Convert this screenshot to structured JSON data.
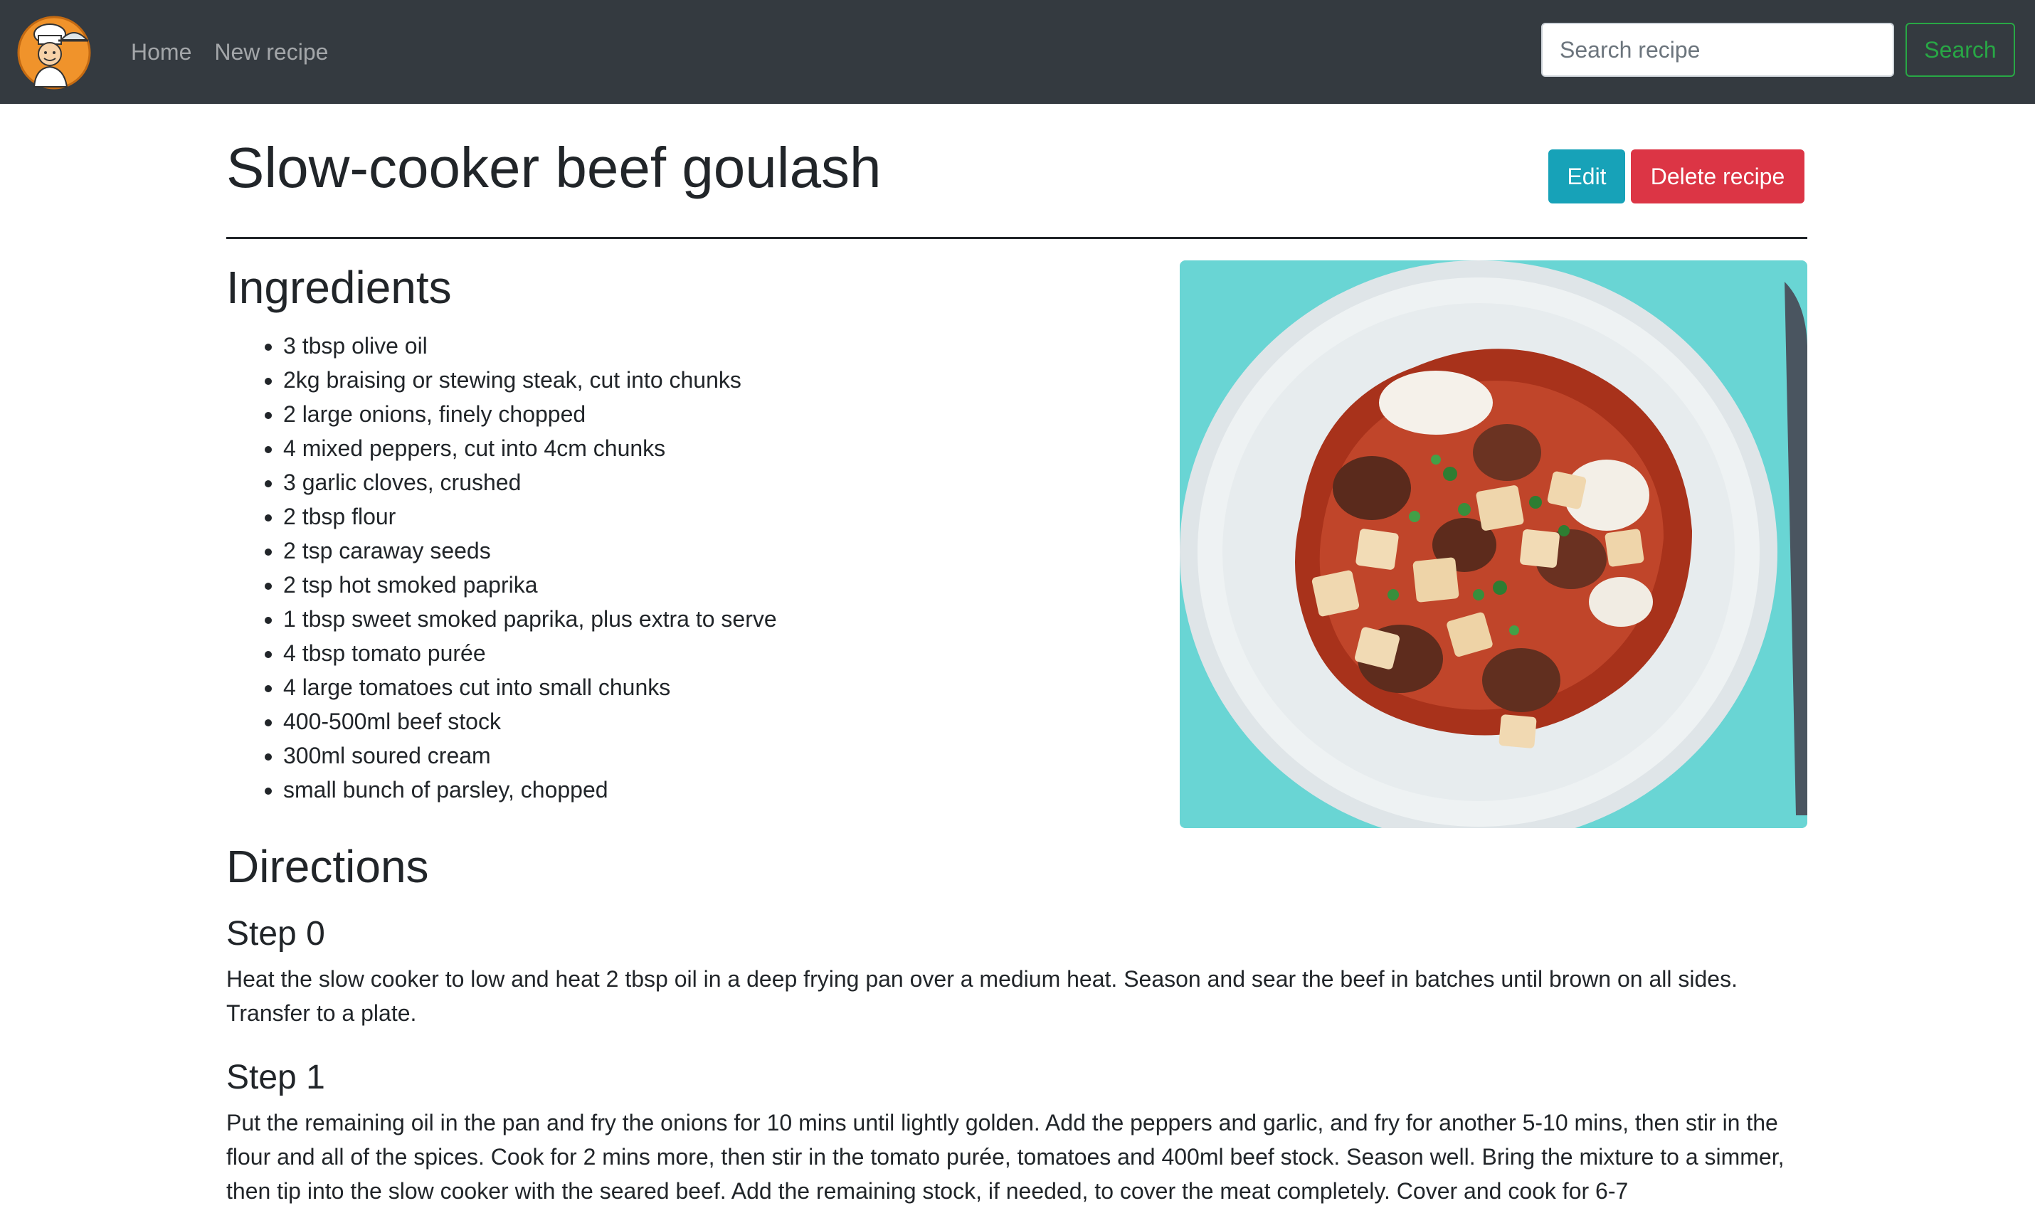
{
  "navbar": {
    "links": [
      "Home",
      "New recipe"
    ],
    "search_placeholder": "Search recipe",
    "search_button": "Search"
  },
  "recipe": {
    "title": "Slow-cooker beef goulash",
    "edit_label": "Edit",
    "delete_label": "Delete recipe",
    "ingredients_heading": "Ingredients",
    "ingredients": [
      "3 tbsp olive oil",
      "2kg braising or stewing steak, cut into chunks",
      "2 large onions, finely chopped",
      "4 mixed peppers, cut into 4cm chunks",
      "3 garlic cloves, crushed",
      "2 tbsp flour",
      "2 tsp caraway seeds",
      "2 tsp hot smoked paprika",
      "1 tbsp sweet smoked paprika, plus extra to serve",
      "4 tbsp tomato purée",
      "4 large tomatoes cut into small chunks",
      "400-500ml beef stock",
      "300ml soured cream",
      "small bunch of parsley, chopped"
    ],
    "directions_heading": "Directions",
    "steps": [
      {
        "title": "Step 0",
        "text": "Heat the slow cooker to low and heat 2 tbsp oil in a deep frying pan over a medium heat. Season and sear the beef in batches until brown on all sides. Transfer to a plate."
      },
      {
        "title": "Step 1",
        "text": "Put the remaining oil in the pan and fry the onions for 10 mins until lightly golden. Add the peppers and garlic, and fry for another 5-10 mins, then stir in the flour and all of the spices. Cook for 2 mins more, then stir in the tomato purée, tomatoes and 400ml beef stock. Season well. Bring the mixture to a simmer, then tip into the slow cooker with the seared beef. Add the remaining stock, if needed, to cover the meat completely. Cover and cook for 6-7"
      }
    ]
  },
  "colors": {
    "navbar_bg": "#343a40",
    "search_accent": "#28a745",
    "edit_button": "#17a2b8",
    "delete_button": "#dc3545",
    "image_bg": "#5ecfcf"
  }
}
